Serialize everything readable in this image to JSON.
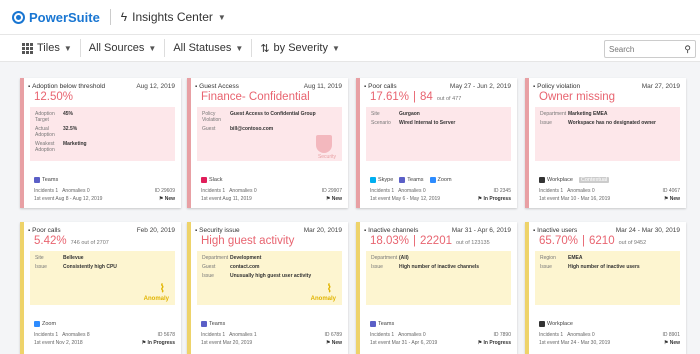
{
  "app": {
    "brand": "PowerSuite",
    "section": "Insights Center"
  },
  "toolbar": {
    "view": "Tiles",
    "sources": "All Sources",
    "statuses": "All Statuses",
    "sort": "by Severity",
    "search_placeholder": "Search"
  },
  "cards": [
    {
      "title": "Adoption below threshold",
      "date": "Aug 12, 2019",
      "value": "12.50%",
      "sub": "",
      "details": [
        {
          "k": "Adoption Target",
          "v": "45%"
        },
        {
          "k": "Actual Adoption",
          "v": "32.5%"
        },
        {
          "k": "Weakest Adoption",
          "v": "Marketing"
        }
      ],
      "apps": [
        "Teams"
      ],
      "incidents": "Incidents 1",
      "anomalies": "Anomalies 0",
      "id": "ID 29609",
      "first": "1st event Aug 8 - Aug 12, 2019",
      "status": "New"
    },
    {
      "title": "Guest Access",
      "date": "Aug 11, 2019",
      "value": "Finance- Confidential",
      "sub": "",
      "details": [
        {
          "k": "Policy Violation",
          "v": "Guest Access to Confidential Group"
        },
        {
          "k": "Guest",
          "v": "bill@contoso.com"
        }
      ],
      "apps": [
        "Slack"
      ],
      "incidents": "Incidents 1",
      "anomalies": "Anomalies 0",
      "id": "ID 29907",
      "first": "1st event Aug 11, 2019",
      "status": "New",
      "badge": "Security"
    },
    {
      "title": "Poor calls",
      "date": "May 27 - Jun 2, 2019",
      "value": "17.61%",
      "value2": "84",
      "sub": "out of 477",
      "details": [
        {
          "k": "Site",
          "v": "Gurgaon"
        },
        {
          "k": "Scenario",
          "v": "Wired Internal to Server"
        }
      ],
      "apps": [
        "Skype",
        "Teams",
        "Zoom"
      ],
      "incidents": "Incidents 1",
      "anomalies": "Anomalies 0",
      "id": "ID 2345",
      "first": "1st event May 6 - May 12, 2019",
      "status": "In Progress"
    },
    {
      "title": "Policy violation",
      "date": "Mar 27, 2019",
      "value": "Owner missing",
      "sub": "",
      "details": [
        {
          "k": "Department",
          "v": "Marketing EMEA"
        },
        {
          "k": "Issue",
          "v": "Workspace has no designated owner"
        }
      ],
      "apps": [
        "Workplace",
        "Contextual"
      ],
      "incidents": "Incidents 1",
      "anomalies": "Anomalies 0",
      "id": "ID 4067",
      "first": "1st event Mar 10 - Mar 16, 2019",
      "status": "New"
    },
    {
      "title": "Poor calls",
      "date": "Feb 20, 2019",
      "value": "5.42%",
      "sub": "746 out of 2707",
      "details": [
        {
          "k": "Site",
          "v": "Bellevue"
        },
        {
          "k": "Issue",
          "v": "Consistently high CPU"
        }
      ],
      "apps": [
        "Zoom"
      ],
      "incidents": "Incidents 1",
      "anomalies": "Anomalies 8",
      "id": "ID 5678",
      "first": "1st event Nov 2, 2018",
      "status": "In Progress",
      "badge": "Anomaly"
    },
    {
      "title": "Security issue",
      "date": "Mar 20, 2019",
      "value": "High guest activity",
      "sub": "",
      "details": [
        {
          "k": "Department",
          "v": "Development"
        },
        {
          "k": "Guest",
          "v": "contact.com"
        },
        {
          "k": "Issue",
          "v": "Unusually high guest user activity"
        }
      ],
      "apps": [
        "Teams"
      ],
      "incidents": "Incidents 1",
      "anomalies": "Anomalies 1",
      "id": "ID 6789",
      "first": "1st event Mar 20, 2019",
      "status": "New",
      "badge": "Anomaly"
    },
    {
      "title": "Inactive channels",
      "date": "Mar 31 - Apr 6, 2019",
      "value": "18.03%",
      "value2": "22201",
      "sub": "out of 123135",
      "details": [
        {
          "k": "Department",
          "v": "(All)"
        },
        {
          "k": "Issue",
          "v": "High number of inactive channels"
        }
      ],
      "apps": [
        "Teams"
      ],
      "incidents": "Incidents 1",
      "anomalies": "Anomalies 0",
      "id": "ID 7890",
      "first": "1st event Mar 31 - Apr 6, 2019",
      "status": "In Progress"
    },
    {
      "title": "Inactive users",
      "date": "Mar 24 - Mar 30, 2019",
      "value": "65.70%",
      "value2": "6210",
      "sub": "out of 9452",
      "details": [
        {
          "k": "Region",
          "v": "EMEA"
        },
        {
          "k": "Issue",
          "v": "High number of inactive users"
        }
      ],
      "apps": [
        "Workplace"
      ],
      "incidents": "Incidents 1",
      "anomalies": "Anomalies 0",
      "id": "ID 8901",
      "first": "1st event Mar 24 - Mar 30, 2019",
      "status": "New"
    }
  ]
}
